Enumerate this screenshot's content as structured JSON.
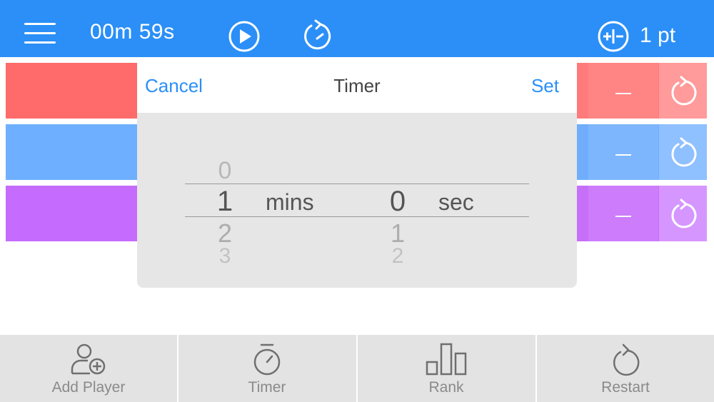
{
  "header": {
    "timer_display": "00m 59s",
    "points_label": "1 pt",
    "menu_icon": "hamburger-menu-icon",
    "play_icon": "play-icon",
    "reset_timer_icon": "reset-timer-icon",
    "plusminus_icon": "plus-minus-icon"
  },
  "players": [
    {
      "color": "#ff6b6b",
      "right_color": "#ff8585",
      "reset_color": "#ff9b9b"
    },
    {
      "color": "#6eb0ff",
      "right_color": "#7db6fc",
      "reset_color": "#8fc0ff"
    },
    {
      "color": "#c56cff",
      "right_color": "#cd7cfc",
      "reset_color": "#d696ff"
    }
  ],
  "picker": {
    "cancel_label": "Cancel",
    "title": "Timer",
    "set_label": "Set",
    "minutes": {
      "above": "0",
      "selected": "1",
      "below1": "2",
      "below2": "3"
    },
    "seconds": {
      "selected": "0",
      "below1": "1",
      "below2": "2"
    },
    "minutes_unit": "mins",
    "seconds_unit": "sec"
  },
  "toolbar": {
    "items": [
      {
        "label": "Add Player",
        "icon": "add-player-icon"
      },
      {
        "label": "Timer",
        "icon": "stopwatch-icon"
      },
      {
        "label": "Rank",
        "icon": "bar-chart-icon"
      },
      {
        "label": "Restart",
        "icon": "restart-icon"
      }
    ]
  }
}
